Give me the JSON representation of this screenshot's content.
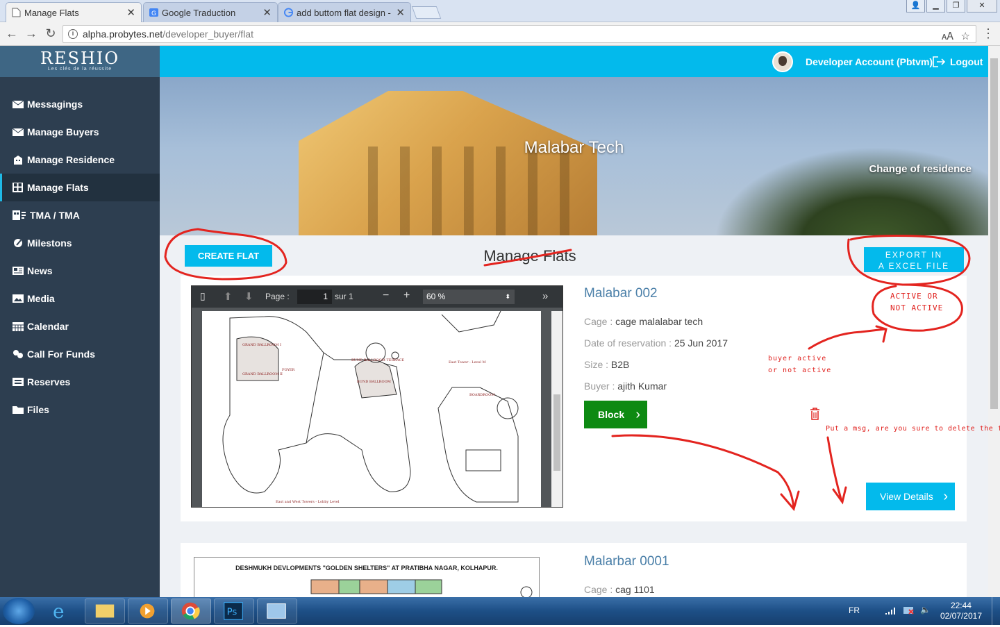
{
  "browser": {
    "tabs": [
      {
        "title": "Manage Flats",
        "active": true
      },
      {
        "title": "Google Traduction",
        "active": false
      },
      {
        "title": "add buttom flat design -",
        "active": false
      }
    ],
    "url_host": "alpha.probytes.net",
    "url_path": "/developer_buyer/flat"
  },
  "sidebar": {
    "logo": "RESHIO",
    "logo_tagline": "Les clés de la réussite",
    "items": [
      {
        "label": "Messagings",
        "icon": "envelope-icon"
      },
      {
        "label": "Manage Buyers",
        "icon": "envelope-icon"
      },
      {
        "label": "Manage Residence",
        "icon": "building-icon"
      },
      {
        "label": "Manage Flats",
        "icon": "grid-icon",
        "active": true
      },
      {
        "label": "TMA / TMA",
        "icon": "tma-icon"
      },
      {
        "label": "Milestons",
        "icon": "flag-icon"
      },
      {
        "label": "News",
        "icon": "newspaper-icon"
      },
      {
        "label": "Media",
        "icon": "image-icon"
      },
      {
        "label": "Calendar",
        "icon": "calendar-icon"
      },
      {
        "label": "Call For Funds",
        "icon": "funds-icon"
      },
      {
        "label": "Reserves",
        "icon": "reserves-icon"
      },
      {
        "label": "Files",
        "icon": "folder-icon"
      }
    ]
  },
  "header": {
    "account": "Developer Account (Pbtvm)",
    "logout": "Logout"
  },
  "banner": {
    "title": "Malabar Tech",
    "change_residence": "Change of residence"
  },
  "main": {
    "create_button": "CREATE FLAT",
    "page_title": "Manage Flats",
    "export_button_line1": "EXPORT IN",
    "export_button_line2": "A EXCEL FILE"
  },
  "pdf_viewer": {
    "page_label": "Page :",
    "page_value": "1",
    "page_total": "sur 1",
    "zoom": "60 %",
    "plan_labels": {
      "ballroom1": "GRAND BALLROOM I",
      "ballroom2": "GRAND BALLROOM II",
      "foyer": "FOYER",
      "bund": "BUND BALLROOM",
      "terrace": "BUND BALLROOM TERRACE",
      "east_tower": "East Tower - Level M",
      "boardroom": "BOARDROOM",
      "lobby": "East and West Towers - Lobby Level"
    }
  },
  "flats": [
    {
      "name": "Malabar 002",
      "cage_label": "Cage : ",
      "cage": "cage malalabar tech",
      "date_label": "Date of reservation : ",
      "date": "25 Jun 2017",
      "size_label": "Size : ",
      "size": "B2B",
      "buyer_label": "Buyer : ",
      "buyer": "ajith Kumar",
      "block_button": "Block",
      "view_button": "View Details"
    },
    {
      "name": "Malarbar 0001",
      "cage_label": "Cage : ",
      "cage": "cag 1101",
      "plan_title": "DESHMUKH DEVLOPMENTS \"GOLDEN SHELTERS\" AT PRATIBHA NAGAR, KOLHAPUR."
    }
  ],
  "annotations": {
    "active_line1": "ACTIVE OR",
    "active_line2": "NOT ACTIVE",
    "buyer_line1": "buyer active",
    "buyer_line2": "or not active",
    "delete_msg": "Put a msg, are you sure to delete the flat?"
  },
  "taskbar": {
    "lang": "FR",
    "time": "22:44",
    "date": "02/07/2017"
  },
  "colors": {
    "accent": "#03baec",
    "sidebar": "#2d3e50",
    "block": "#0d8a12",
    "ink": "#e0201d"
  }
}
